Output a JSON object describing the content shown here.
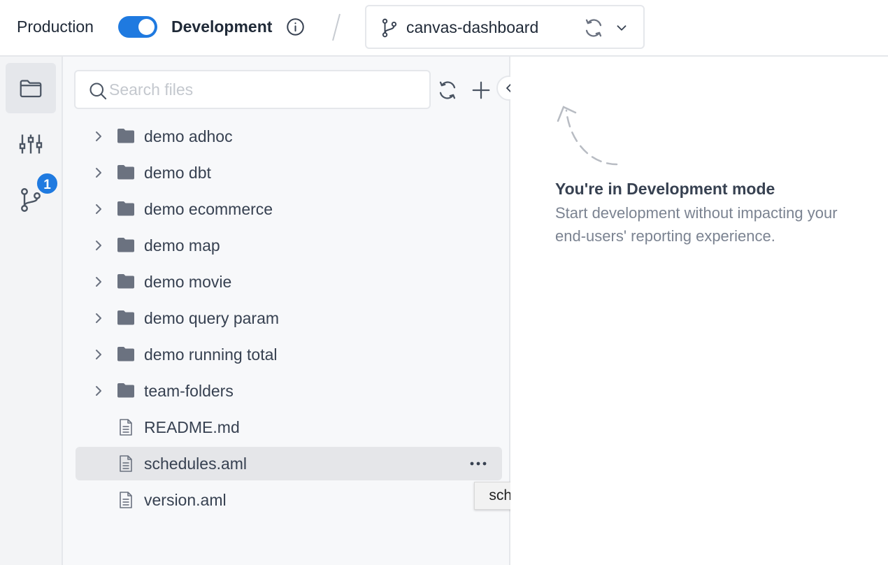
{
  "header": {
    "production_label": "Production",
    "development_label": "Development",
    "mode_toggle_on": true,
    "branch_name": "canvas-dashboard"
  },
  "sidebar": {
    "rail_items": [
      {
        "name": "files",
        "icon": "folder-icon",
        "active": true
      },
      {
        "name": "settings",
        "icon": "sliders-icon",
        "active": false
      },
      {
        "name": "version-control",
        "icon": "git-branch-icon",
        "active": false
      }
    ],
    "git_badge_count": "1"
  },
  "file_panel": {
    "search_placeholder": "Search files",
    "items": [
      {
        "type": "folder",
        "label": "demo adhoc"
      },
      {
        "type": "folder",
        "label": "demo dbt"
      },
      {
        "type": "folder",
        "label": "demo ecommerce"
      },
      {
        "type": "folder",
        "label": "demo map"
      },
      {
        "type": "folder",
        "label": "demo movie"
      },
      {
        "type": "folder",
        "label": "demo query param"
      },
      {
        "type": "folder",
        "label": "demo running total"
      },
      {
        "type": "folder",
        "label": "team-folders"
      },
      {
        "type": "file",
        "label": "README.md"
      },
      {
        "type": "file",
        "label": "schedules.aml",
        "selected": true
      },
      {
        "type": "file",
        "label": "version.aml"
      }
    ],
    "tooltip": "schedules.aml"
  },
  "main": {
    "empty_title": "You're in Development mode",
    "empty_description": "Start development without impacting your end-users' reporting experience."
  },
  "colors": {
    "accent": "#1f7ae0",
    "folder": "#6b7280",
    "border": "#e5e7eb"
  }
}
